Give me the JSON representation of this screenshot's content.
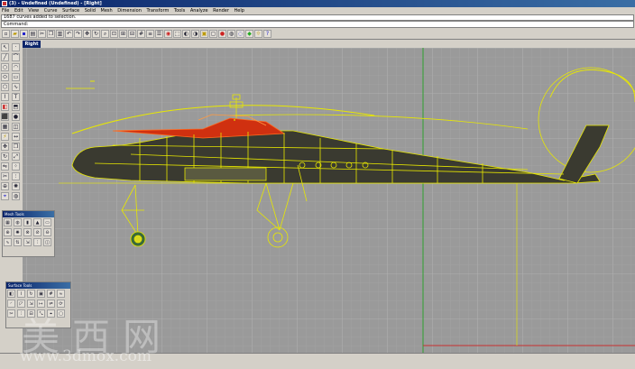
{
  "window": {
    "title": "(3) - Undefined (Undefined) - [Right]"
  },
  "menu": {
    "items": [
      "File",
      "Edit",
      "View",
      "Curve",
      "Surface",
      "Solid",
      "Mesh",
      "Dimension",
      "Transform",
      "Tools",
      "Analyze",
      "Render",
      "Help"
    ]
  },
  "command": {
    "history": "1687 curves added to selection.",
    "prompt": "Command:"
  },
  "viewport": {
    "label": "Right"
  },
  "palettes": {
    "mesh_title": "Mesh Tools",
    "surface_title": "Surface Tools"
  },
  "watermark": {
    "chinese": "美西网",
    "url": "www.3dmox.com"
  },
  "colors": {
    "grid_bg": "#9a9a9a",
    "wire": "#e8e800",
    "highlight": "#e03010",
    "x_axis": "#c83030",
    "y_axis": "#30a030"
  },
  "toolbar_icons": [
    "new-icon",
    "open-icon",
    "save-icon",
    "print-icon",
    "cut-icon",
    "copy-icon",
    "paste-icon",
    "undo-icon",
    "redo-icon",
    "pan-icon",
    "rotate-icon",
    "zoom-icon",
    "zoom-window-icon",
    "zoom-extents-icon",
    "zoom-selected-icon",
    "grid-icon",
    "layer-icon",
    "properties-icon",
    "object-snap-icon",
    "select-icon",
    "hide-icon",
    "show-icon",
    "lock-icon",
    "unlock-icon",
    "render-icon",
    "shade-icon",
    "wireframe-icon",
    "material-icon",
    "light-icon",
    "help-icon"
  ]
}
